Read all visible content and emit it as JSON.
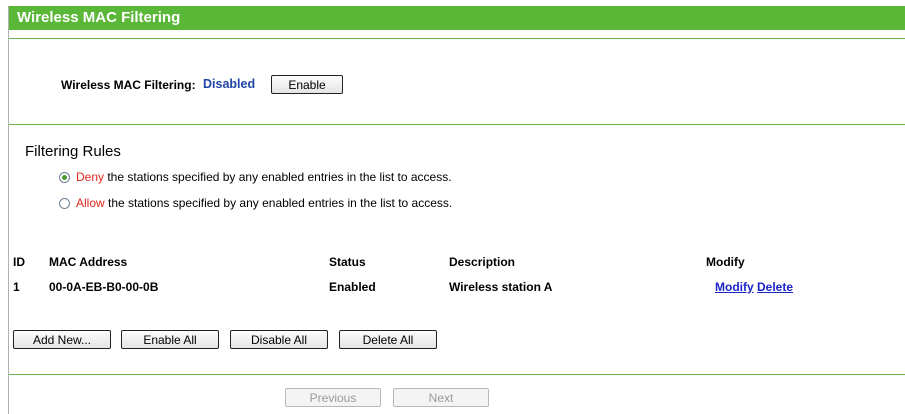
{
  "header": {
    "title": "Wireless MAC Filtering"
  },
  "status_row": {
    "label": "Wireless MAC Filtering:",
    "value": "Disabled",
    "enable_button": "Enable"
  },
  "rules": {
    "title": "Filtering Rules",
    "options": [
      {
        "keyword": "Deny",
        "text": " the stations specified by any enabled entries in the list to access.",
        "selected": true
      },
      {
        "keyword": "Allow",
        "text": " the stations specified by any enabled entries in the list to access.",
        "selected": false
      }
    ]
  },
  "table": {
    "columns": [
      "ID",
      "MAC Address",
      "Status",
      "Description",
      "Modify"
    ],
    "rows": [
      {
        "id": "1",
        "mac": "00-0A-EB-B0-00-0B",
        "status": "Enabled",
        "description": "Wireless station A",
        "modify": "Modify",
        "delete": "Delete"
      }
    ]
  },
  "actions": {
    "add_new": "Add New...",
    "enable_all": "Enable All",
    "disable_all": "Disable All",
    "delete_all": "Delete All"
  },
  "pager": {
    "previous": "Previous",
    "next": "Next"
  },
  "colors": {
    "title_bar": "#5bb738",
    "divider": "#6bb24f",
    "value_blue": "#2045a8",
    "keyword_red": "#e0261c",
    "link_blue": "#1b25c8"
  }
}
